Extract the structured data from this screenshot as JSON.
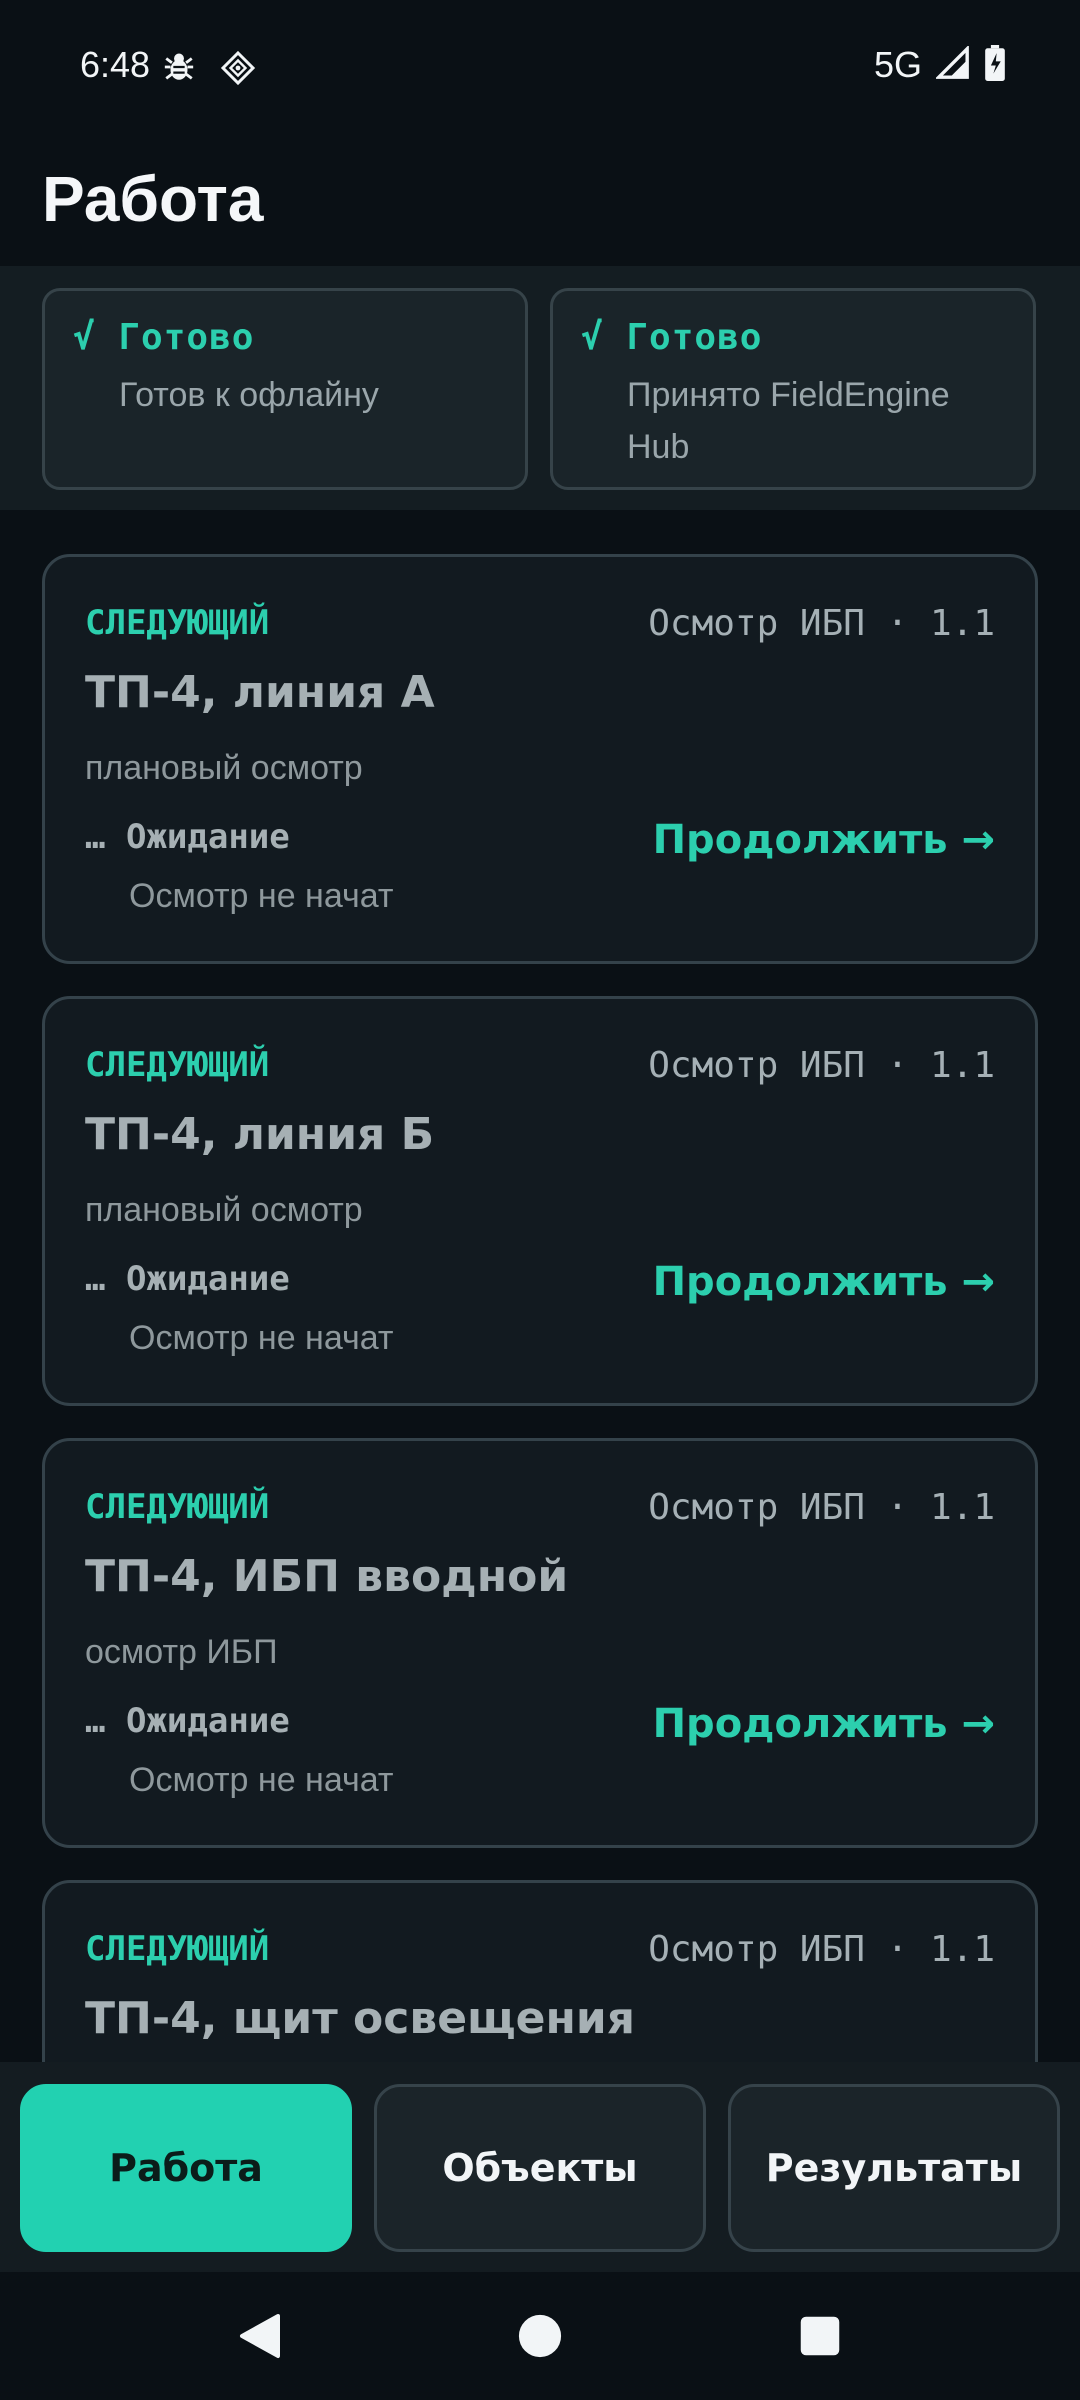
{
  "status_bar": {
    "time": "6:48",
    "network": "5G",
    "icons": [
      "bug-icon",
      "diamond-grid-icon",
      "signal-icon",
      "battery-charging-icon"
    ]
  },
  "page": {
    "title": "Работа"
  },
  "readiness": [
    {
      "mark": "√",
      "label": "Готово",
      "text": "Готов к офлайну"
    },
    {
      "mark": "√",
      "label": "Готово",
      "text": "Принято FieldEngine Hub"
    }
  ],
  "tasks": [
    {
      "tag": "СЛЕДУЮЩИЙ",
      "form": "Осмотр ИБП · 1.1",
      "title": "ТП-4, линия А",
      "subtitle": "плановый осмотр",
      "status_mark": "…",
      "status": "Ожидание",
      "status_text": "Осмотр не начат",
      "action": "Продолжить →"
    },
    {
      "tag": "СЛЕДУЮЩИЙ",
      "form": "Осмотр ИБП · 1.1",
      "title": "ТП-4, линия Б",
      "subtitle": "плановый осмотр",
      "status_mark": "…",
      "status": "Ожидание",
      "status_text": "Осмотр не начат",
      "action": "Продолжить →"
    },
    {
      "tag": "СЛЕДУЮЩИЙ",
      "form": "Осмотр ИБП · 1.1",
      "title": "ТП-4, ИБП вводной",
      "subtitle": "осмотр ИБП",
      "status_mark": "…",
      "status": "Ожидание",
      "status_text": "Осмотр не начат",
      "action": "Продолжить →"
    },
    {
      "tag": "СЛЕДУЮЩИЙ",
      "form": "Осмотр ИБП · 1.1",
      "title": "ТП-4, щит освещения",
      "subtitle": "",
      "status_mark": "",
      "status": "",
      "status_text": "",
      "action": ""
    }
  ],
  "tabs": [
    {
      "label": "Работа",
      "active": true
    },
    {
      "label": "Объекты",
      "active": false
    },
    {
      "label": "Результаты",
      "active": false
    }
  ],
  "colors": {
    "accent": "#22d1b1",
    "background": "#0a1015",
    "card": "#121a20"
  }
}
